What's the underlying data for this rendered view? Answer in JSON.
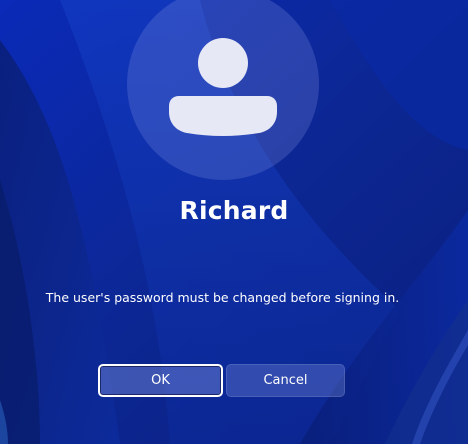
{
  "dialog": {
    "username": "Richard",
    "message": "The user's password must be changed before signing in.",
    "ok_label": "OK",
    "cancel_label": "Cancel"
  },
  "colors": {
    "background": "#0b2a9e",
    "text": "#ffffff",
    "avatar_glyph": "#e6e8f6"
  },
  "icons": {
    "avatar": "user-icon"
  }
}
